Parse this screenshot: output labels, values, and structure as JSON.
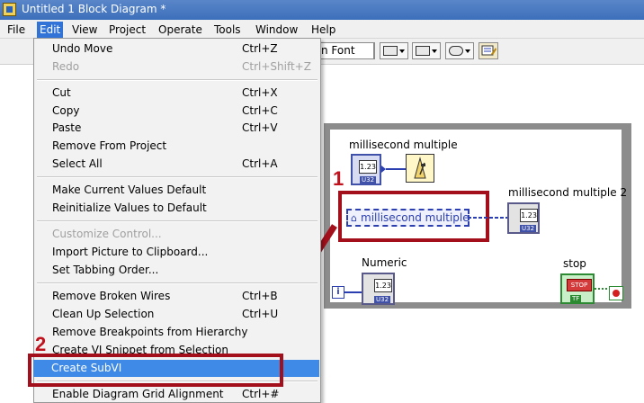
{
  "window": {
    "title": "Untitled 1 Block Diagram *"
  },
  "menubar": {
    "items": [
      {
        "label": "File"
      },
      {
        "label": "Edit"
      },
      {
        "label": "View"
      },
      {
        "label": "Project"
      },
      {
        "label": "Operate"
      },
      {
        "label": "Tools"
      },
      {
        "label": "Window"
      },
      {
        "label": "Help"
      }
    ]
  },
  "toolbar": {
    "font_label": "n Font"
  },
  "edit_menu": {
    "items": [
      {
        "label": "Undo Move",
        "shortcut": "Ctrl+Z",
        "enabled": true
      },
      {
        "label": "Redo",
        "shortcut": "Ctrl+Shift+Z",
        "enabled": false
      },
      {
        "label": "Cut",
        "shortcut": "Ctrl+X",
        "enabled": true
      },
      {
        "label": "Copy",
        "shortcut": "Ctrl+C",
        "enabled": true
      },
      {
        "label": "Paste",
        "shortcut": "Ctrl+V",
        "enabled": true
      },
      {
        "label": "Remove From Project",
        "shortcut": "",
        "enabled": true
      },
      {
        "label": "Select All",
        "shortcut": "Ctrl+A",
        "enabled": true
      },
      {
        "label": "Make Current Values Default",
        "shortcut": "",
        "enabled": true
      },
      {
        "label": "Reinitialize Values to Default",
        "shortcut": "",
        "enabled": true
      },
      {
        "label": "Customize Control...",
        "shortcut": "",
        "enabled": false
      },
      {
        "label": "Import Picture to Clipboard...",
        "shortcut": "",
        "enabled": true
      },
      {
        "label": "Set Tabbing Order...",
        "shortcut": "",
        "enabled": true
      },
      {
        "label": "Remove Broken Wires",
        "shortcut": "Ctrl+B",
        "enabled": true
      },
      {
        "label": "Clean Up Selection",
        "shortcut": "Ctrl+U",
        "enabled": true
      },
      {
        "label": "Remove Breakpoints from Hierarchy",
        "shortcut": "",
        "enabled": true
      },
      {
        "label": "Create VI Snippet from Selection",
        "shortcut": "",
        "enabled": true
      },
      {
        "label": "Create SubVI",
        "shortcut": "",
        "enabled": true,
        "highlighted": true
      },
      {
        "label": "Enable Diagram Grid Alignment",
        "shortcut": "Ctrl+#",
        "enabled": true
      }
    ]
  },
  "diagram": {
    "labels": {
      "ms_multiple": "millisecond multiple",
      "ms_multiple_local": "millisecond multiple",
      "ms_multiple_2": "millisecond multiple 2",
      "numeric": "Numeric",
      "stop": "stop"
    },
    "terminal_tags": {
      "u32": "U32",
      "tf": "TF",
      "stop_face": "STOP",
      "num_face": "1.23",
      "iteration": "i"
    }
  },
  "annotations": {
    "step1": "1",
    "step2": "2"
  },
  "colors": {
    "annotation_red": "#c0121d",
    "menu_highlight": "#3e8ae6",
    "loop_border": "#8c8c8c"
  }
}
